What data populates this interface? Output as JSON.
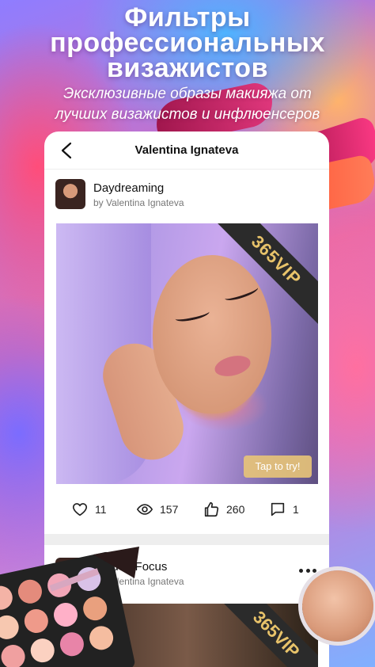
{
  "promo": {
    "headline_line1": "Фильтры",
    "headline_line2": "профессиональных",
    "headline_line3": "визажистов",
    "subline_line1": "Эксклюзивные образы макияжа от",
    "subline_line2": "лучших визажистов и инфлюенсеров"
  },
  "nav": {
    "title": "Valentina Ignateva",
    "back_icon": "chevron-left-icon"
  },
  "post1": {
    "title": "Daydreaming",
    "author": "by Valentina Ignateva",
    "badge": "365VIP",
    "try_label": "Tap to try!",
    "likes": "11",
    "views": "157",
    "thumbs": "260",
    "comments": "1"
  },
  "post2": {
    "title": "Golden Focus",
    "author": "by Valentina Ignateva",
    "badge": "365VIP",
    "more_icon": "more-horizontal-icon"
  },
  "colors": {
    "vip_gold": "#e8c36a",
    "try_button": "#e8c478"
  }
}
